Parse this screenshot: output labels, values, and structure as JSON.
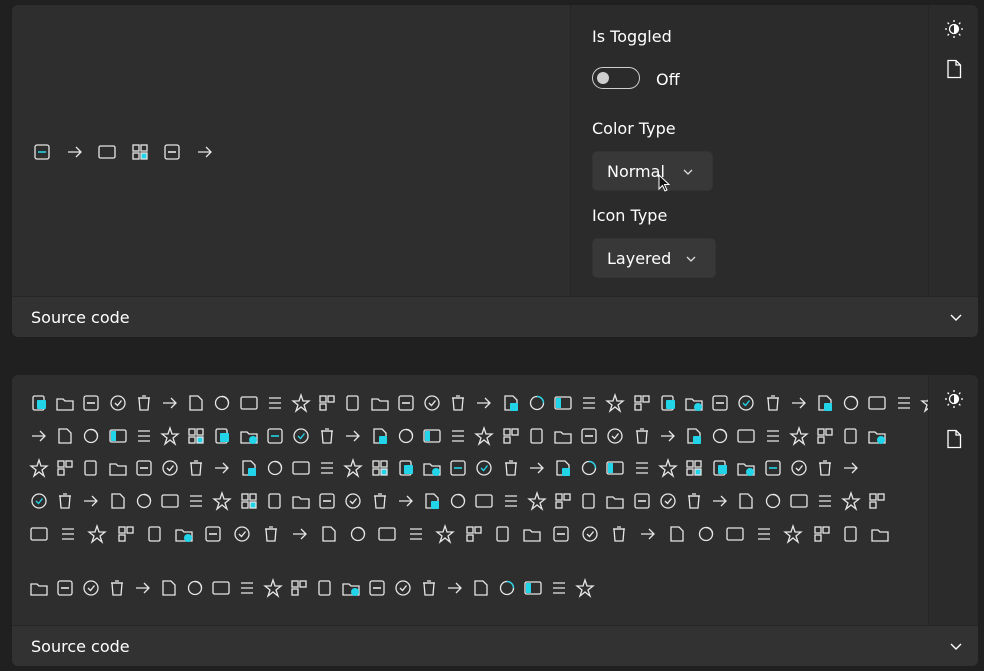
{
  "colors": {
    "accent": "#4cc2ff",
    "cyan": "#21d4e8",
    "text": "#ffffff",
    "panel": "#2b2b2b"
  },
  "card1": {
    "icons": [
      "copy-icon",
      "paste-icon",
      "delete-icon",
      "rename-icon",
      "refresh-icon",
      "share-icon"
    ],
    "options": {
      "toggle_label": "Is Toggled",
      "toggle_state": "Off",
      "color_label": "Color Type",
      "color_value": "Normal",
      "icon_label": "Icon Type",
      "icon_value": "Layered"
    },
    "footer_label": "Source code",
    "toolbar": [
      "theme-toggle-icon",
      "document-icon"
    ]
  },
  "card2": {
    "footer_label": "Source code",
    "toolbar": [
      "theme-toggle-icon",
      "document-icon"
    ],
    "icon_rows": [
      [
        "open-with-icon",
        "folder-move-icon",
        "folder-icon",
        "recycle-icon",
        "delete-icon",
        "check-circle-icon",
        "pause-circle-icon",
        "info-circle-icon",
        "eject-icon",
        "arrow-right-icon",
        "arrow-up-icon",
        "arrow-left-icon",
        "refresh-icon",
        "arrow-right-small-icon",
        "arrow-up-small-icon",
        "arrow-left-small-icon",
        "refresh-small-icon",
        "cut-icon",
        "copy-icon",
        "paste-icon",
        "paste-link-icon",
        "app-icon",
        "rename-icon",
        "delete-icon",
        "bin-restore-icon",
        "select-all-icon",
        "grid-icon",
        "selection-icon",
        "tag-check-icon",
        "image-icon",
        "checklist-icon",
        "info-icon",
        "wrench-icon",
        "pin-icon",
        "tag-icon"
      ],
      [
        "tag-alt-icon",
        "shrink-icon",
        "expand-icon",
        "share-icon",
        "file-icon",
        "folder-icon",
        "folder-badge-icon",
        "open-box-icon",
        "link-icon",
        "copy-link-icon",
        "folder-arrow-icon",
        "gear-icon",
        "more-icon",
        "folder-sync-icon",
        "folder-down-icon",
        "folder-check-icon",
        "folder-check-alt-icon",
        "sparkle-icon",
        "screen-icon",
        "chevron-bar-icon",
        "search-icon",
        "search-alt-icon",
        "star-icon",
        "star-add-icon",
        "pin-on-icon",
        "pin-off-icon",
        "arrow-down-icon",
        "upload-icon",
        "sync-icon",
        "commit-icon",
        "target-icon",
        "branch-icon",
        "branch-add-icon"
      ],
      [
        "list-icon",
        "git-icon",
        "compare-icon",
        "outline-icon",
        "sort-icon",
        "filter-icon",
        "import-icon",
        "export-icon",
        "projector-icon",
        "form-icon",
        "plus-circle-icon",
        "file-add-icon",
        "window-add-icon",
        "window-add-alt-icon",
        "folder-add-icon",
        "window-plus-icon",
        "terminal-icon",
        "arrow-circle-icon",
        "terminal-arrow-icon",
        "share-window-icon",
        "file-share-icon",
        "window-share-icon",
        "window-share-alt-icon",
        "panel-left-icon",
        "panel-x-icon",
        "panel-right-icon",
        "panel-dual-icon",
        "panel-bottom-icon",
        "panel-close-icon",
        "document-lines-icon",
        "shield-icon",
        "info-file-icon"
      ],
      [
        "window-check-icon",
        "open-in-new-icon",
        "signature-icon",
        "certificate-icon",
        "file-settings-icon",
        "settings-icon",
        "palette-icon",
        "grid-four-icon",
        "copy-pages-icon",
        "keyboard-icon",
        "window-frame-icon",
        "window-blank-icon",
        "document-alt-icon",
        "paint-bucket-icon",
        "brush-icon",
        "sync-window-icon",
        "book-edit-icon",
        "file-gear-icon",
        "slash-box-icon",
        "library-icon",
        "split-view-icon",
        "language-icon",
        "calendar-clock-icon",
        "power-icon",
        "home-icon",
        "hatched-icon",
        "picture-icon",
        "tablet-icon",
        "dot-line-icon",
        "image-alt-icon",
        "checkmark-circle-icon",
        "arrow-diag-icon",
        "warning-dash-icon"
      ],
      [
        "cursor-window-icon",
        "click-icon",
        "chevron-updown-icon",
        "resize-icon",
        "pencil-icon",
        "list-check-icon",
        "network-icon",
        "align-right-icon",
        "align-left-icon",
        "cube-icon",
        "more-icon",
        "recycle-warning-icon",
        "git-warning-icon",
        "file-warning-icon",
        "book-open-icon",
        "help-bubble-icon",
        "translate-icon",
        "github-icon",
        "lock-icon",
        "bullet-list-icon",
        "boxes-icon",
        "picture-frame-icon",
        "pictures-icon",
        "image-frame-icon",
        "image-list-icon",
        "list-checkbox-icon",
        "grid-outline-icon",
        "list-grid-icon",
        "text-list-icon",
        "toggle-text-icon"
      ],
      [
        "columns-icon",
        "bullets-icon",
        "blocks-icon",
        "plus-box-icon",
        "minus-box-icon",
        "exclamation-box-icon",
        "x-box-icon",
        "caret-box-icon",
        "dot-box-icon",
        "shield-box-icon",
        "lock-box-icon",
        "eye-off-icon",
        "sync-cyan-icon",
        "cloud-icon",
        "block-icon",
        "split-icon",
        "corner-icon",
        "half-icon",
        "fill-left-icon",
        "fill-right-icon",
        "fill-top-icon",
        "fill-bottom-icon"
      ]
    ]
  }
}
